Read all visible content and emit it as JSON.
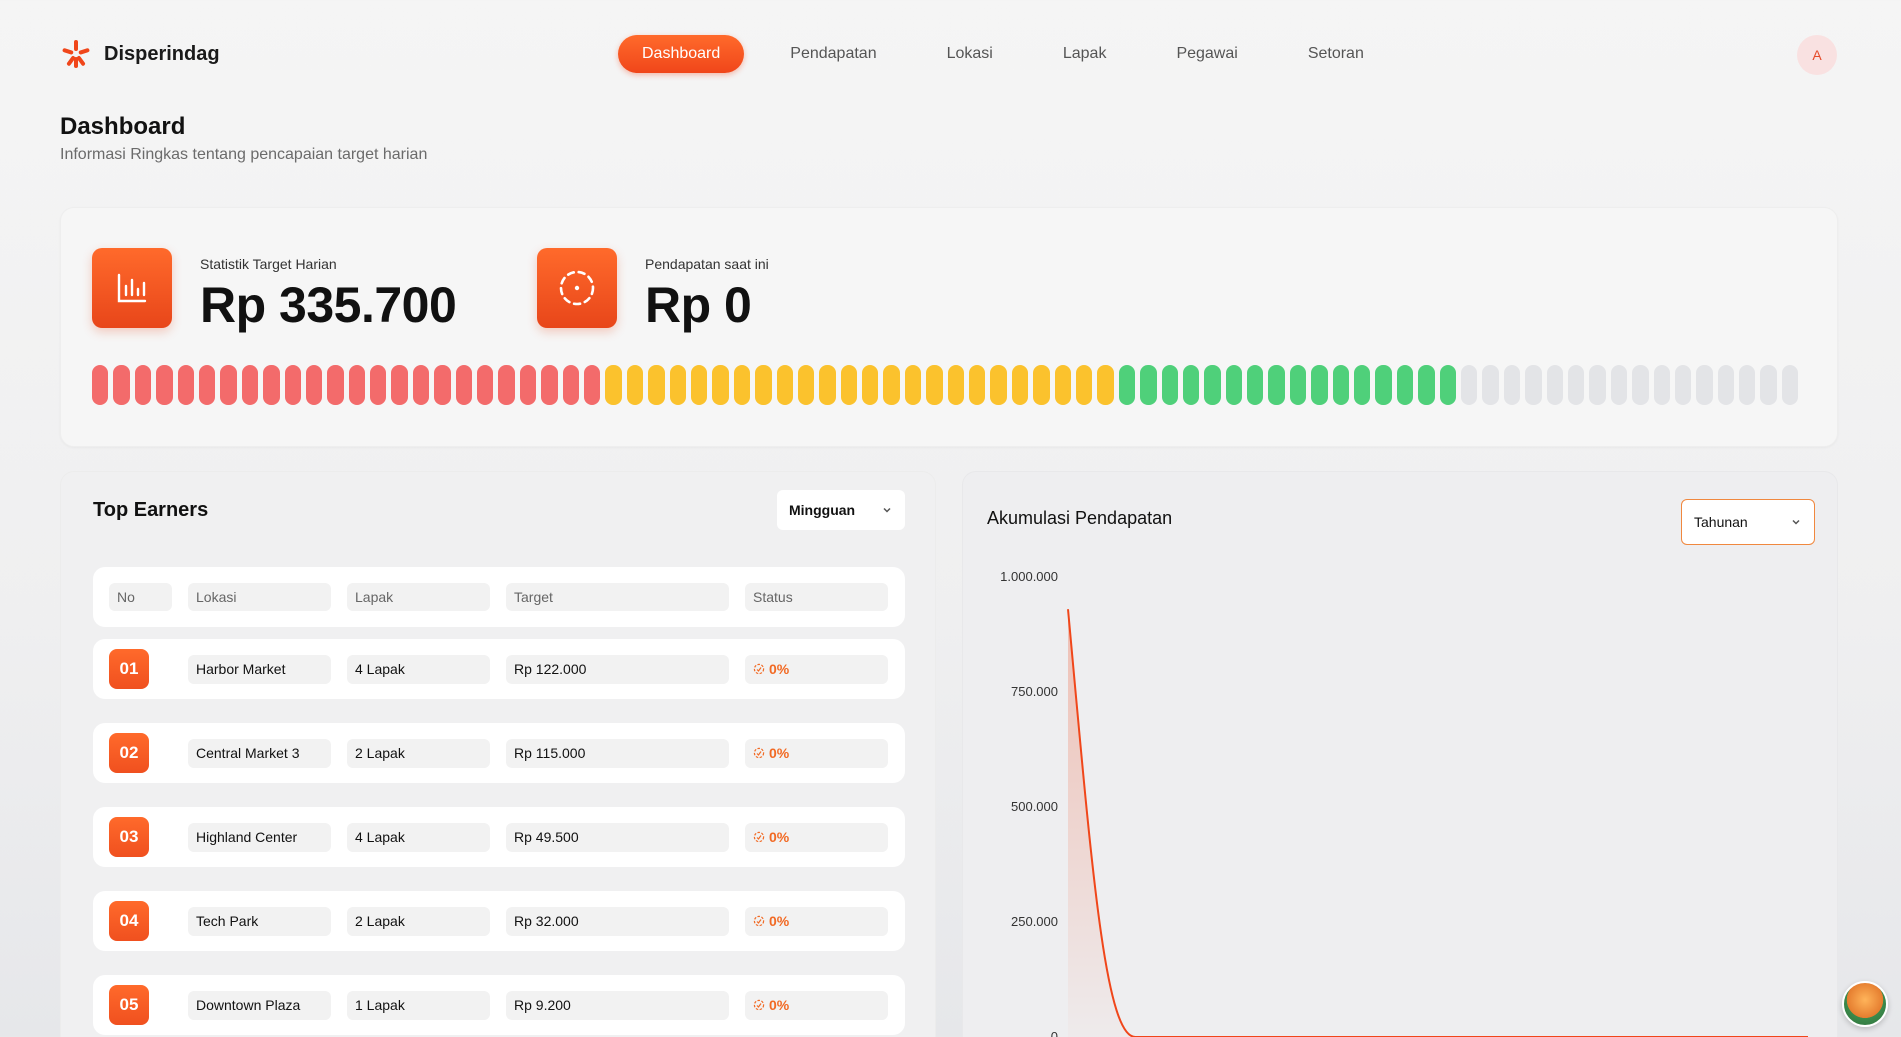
{
  "brand": {
    "name": "Disperindag",
    "color": "#f0461a"
  },
  "nav": {
    "items": [
      {
        "label": "Dashboard",
        "active": true
      },
      {
        "label": "Pendapatan",
        "active": false
      },
      {
        "label": "Lokasi",
        "active": false
      },
      {
        "label": "Lapak",
        "active": false
      },
      {
        "label": "Pegawai",
        "active": false
      },
      {
        "label": "Setoran",
        "active": false
      }
    ],
    "avatar_initial": "A"
  },
  "page": {
    "title": "Dashboard",
    "subtitle": "Informasi Ringkas tentang pencapaian target harian"
  },
  "stats": {
    "target": {
      "label": "Statistik Target Harian",
      "value": "Rp 335.700",
      "icon": "bar-chart-icon"
    },
    "current": {
      "label": "Pendapatan saat ini",
      "value": "Rp 0",
      "icon": "target-dashed-icon"
    },
    "progress_segments": {
      "red": 24,
      "yellow": 24,
      "green": 16,
      "gray": 16
    }
  },
  "earners": {
    "title": "Top Earners",
    "period": "Mingguan",
    "headers": [
      "No",
      "Lokasi",
      "Lapak",
      "Target",
      "Status"
    ],
    "rows": [
      {
        "no": "01",
        "lokasi": "Harbor Market",
        "lapak": "4 Lapak",
        "target": "Rp 122.000",
        "status": "0%"
      },
      {
        "no": "02",
        "lokasi": "Central Market 3",
        "lapak": "2 Lapak",
        "target": "Rp 115.000",
        "status": "0%"
      },
      {
        "no": "03",
        "lokasi": "Highland Center",
        "lapak": "4 Lapak",
        "target": "Rp 49.500",
        "status": "0%"
      },
      {
        "no": "04",
        "lokasi": "Tech Park",
        "lapak": "2 Lapak",
        "target": "Rp 32.000",
        "status": "0%"
      },
      {
        "no": "05",
        "lokasi": "Downtown Plaza",
        "lapak": "1 Lapak",
        "target": "Rp 9.200",
        "status": "0%"
      }
    ]
  },
  "revenue": {
    "title": "Akumulasi Pendapatan",
    "period": "Tahunan"
  },
  "chart_data": {
    "type": "area",
    "title": "Akumulasi Pendapatan",
    "xlabel": "",
    "ylabel": "",
    "ylim": [
      0,
      1000000
    ],
    "yticks": [
      "1.000.000",
      "750.000",
      "500.000",
      "250.000",
      "0"
    ],
    "yticks_values": [
      1000000,
      750000,
      500000,
      250000,
      0
    ],
    "x": [
      0,
      1,
      2,
      3,
      4,
      5,
      6,
      7,
      8,
      9,
      10,
      11
    ],
    "series": [
      {
        "values": [
          930000,
          0,
          0,
          0,
          0,
          0,
          0,
          0,
          0,
          0,
          0,
          0
        ]
      }
    ],
    "line_color": "#f0461a"
  }
}
